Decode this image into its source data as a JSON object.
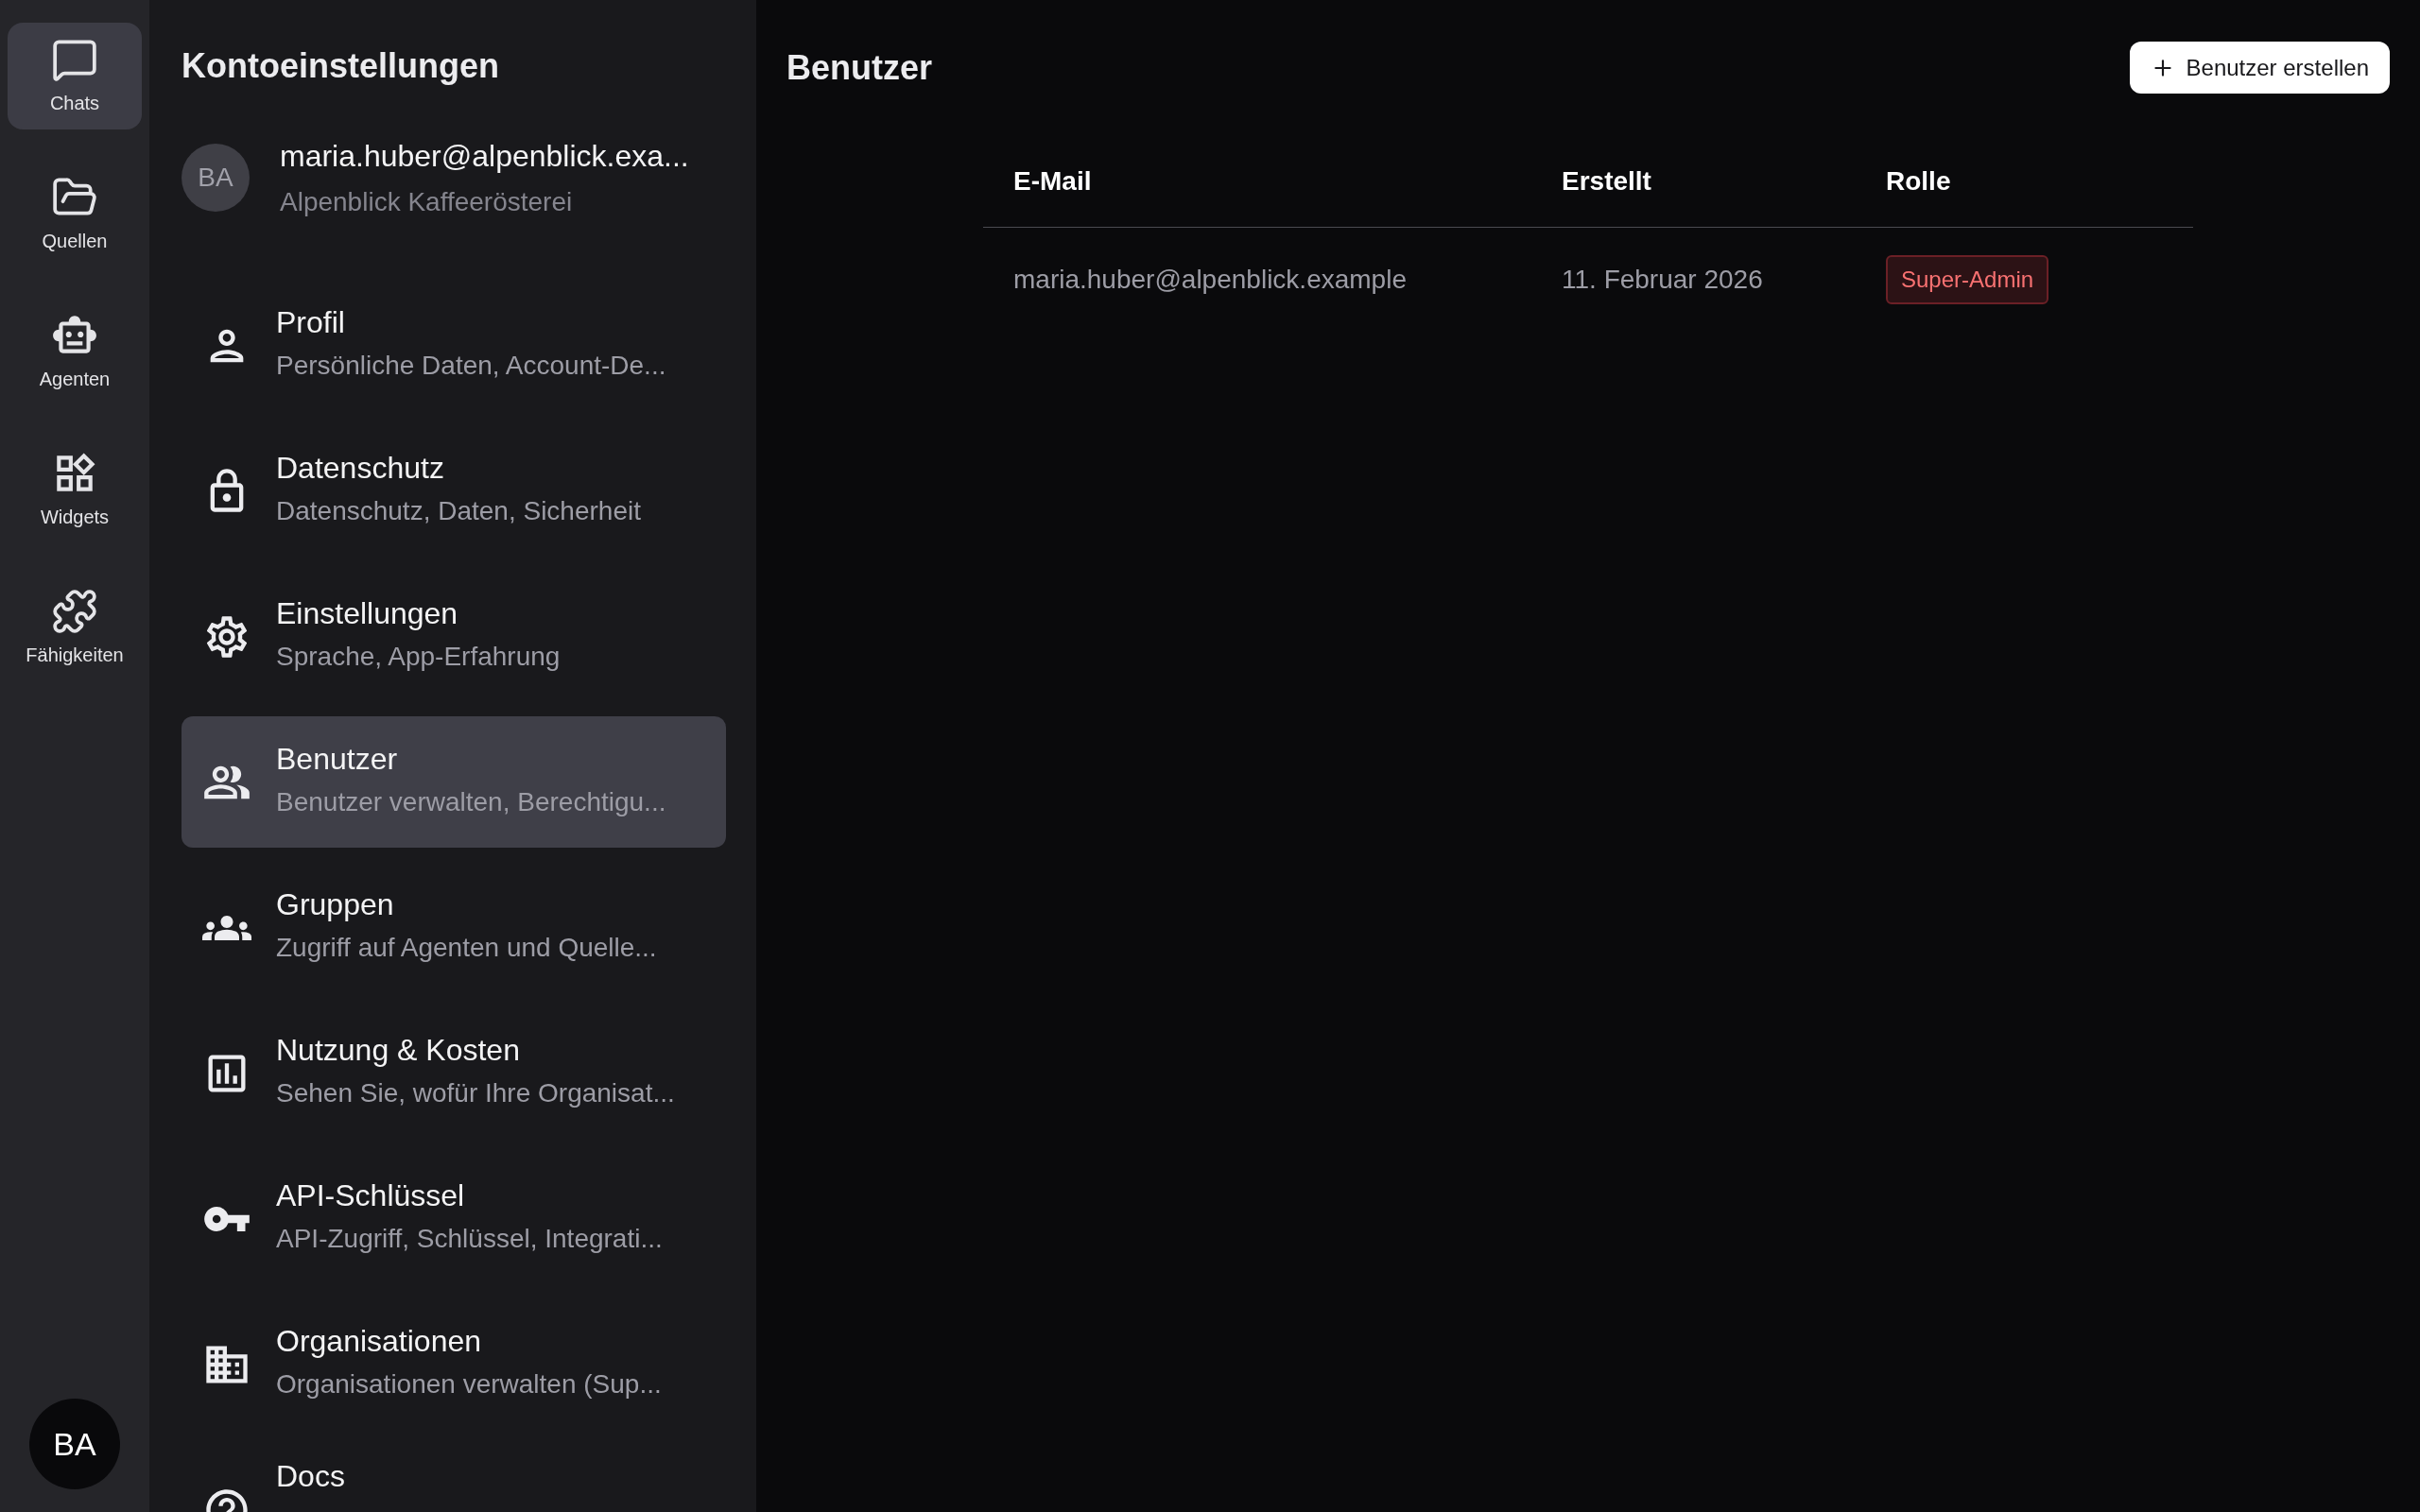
{
  "nav_rail": {
    "items": [
      {
        "label": "Chats",
        "selected": true
      },
      {
        "label": "Quellen",
        "selected": false
      },
      {
        "label": "Agenten",
        "selected": false
      },
      {
        "label": "Widgets",
        "selected": false
      },
      {
        "label": "Fähigkeiten",
        "selected": false
      }
    ],
    "avatar": "BA"
  },
  "settings_sidebar": {
    "title": "Kontoeinstellungen",
    "account": {
      "initials": "BA",
      "email": "maria.huber@alpenblick.exa...",
      "organization": "Alpenblick Kaffeerösterei"
    },
    "items": [
      {
        "title": "Profil",
        "description": "Persönliche Daten, Account-De...",
        "selected": false
      },
      {
        "title": "Datenschutz",
        "description": "Datenschutz, Daten, Sicherheit",
        "selected": false
      },
      {
        "title": "Einstellungen",
        "description": "Sprache, App-Erfahrung",
        "selected": false
      },
      {
        "title": "Benutzer",
        "description": "Benutzer verwalten, Berechtigu...",
        "selected": true
      },
      {
        "title": "Gruppen",
        "description": "Zugriff auf Agenten und Quelle...",
        "selected": false
      },
      {
        "title": "Nutzung & Kosten",
        "description": "Sehen Sie, wofür Ihre Organisat...",
        "selected": false
      },
      {
        "title": "API-Schlüssel",
        "description": "API-Zugriff, Schlüssel, Integrati...",
        "selected": false
      },
      {
        "title": "Organisationen",
        "description": "Organisationen verwalten (Sup...",
        "selected": false
      },
      {
        "title": "Docs",
        "selected": false
      }
    ]
  },
  "main": {
    "title": "Benutzer",
    "create_button": "Benutzer erstellen",
    "table": {
      "columns": [
        "E-Mail",
        "Erstellt",
        "Rolle"
      ],
      "rows": [
        {
          "email": "maria.huber@alpenblick.example",
          "created": "11. Februar 2026",
          "role": "Super-Admin"
        }
      ]
    }
  }
}
